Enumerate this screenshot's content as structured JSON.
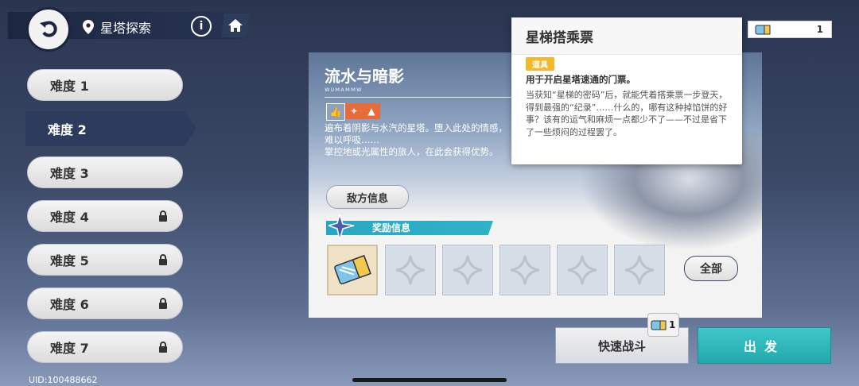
{
  "header": {
    "location_label": "星塔探索"
  },
  "difficulties": [
    {
      "label": "难度 1",
      "locked": false
    },
    {
      "label": "难度 2",
      "locked": false,
      "active": true
    },
    {
      "label": "难度 3",
      "locked": false
    },
    {
      "label": "难度 4",
      "locked": true
    },
    {
      "label": "难度 5",
      "locked": true
    },
    {
      "label": "难度 6",
      "locked": true
    },
    {
      "label": "难度 7",
      "locked": true
    }
  ],
  "stage": {
    "title": "流水与暗影",
    "subtitle": "ᴡᴜᴍᴀᴍᴍᴡ",
    "description_lines": [
      "遍布着阴影与水汽的星塔。堕入此处的情感，",
      "难以呼吸……",
      "掌控地或光属性的旅人，在此会获得优势。"
    ],
    "enemy_info_label": "敌方信息",
    "reward_info_label": "奖励信息",
    "all_label": "全部"
  },
  "buttons": {
    "quick_battle": "快速战斗",
    "quick_battle_count": "1",
    "start": "出发"
  },
  "tooltip": {
    "title": "星梯搭乘票",
    "tag": "道具",
    "use": "用于开启星塔速通的门票。",
    "desc": "当获知“星梯的密码”后，就能凭着搭乘票一步登天，得到最强的“纪录”……什么的，哪有这种掉馅饼的好事？该有的运气和麻烦一点都少不了——不过是省下了一些烦闷的过程罢了。"
  },
  "counter": {
    "value": "1"
  },
  "footer": {
    "uid": "UID:100488662"
  },
  "colors": {
    "accent_teal": "#23a8ad",
    "active_nav": "#2d3b5d",
    "tag_yellow": "#f2b92c"
  }
}
